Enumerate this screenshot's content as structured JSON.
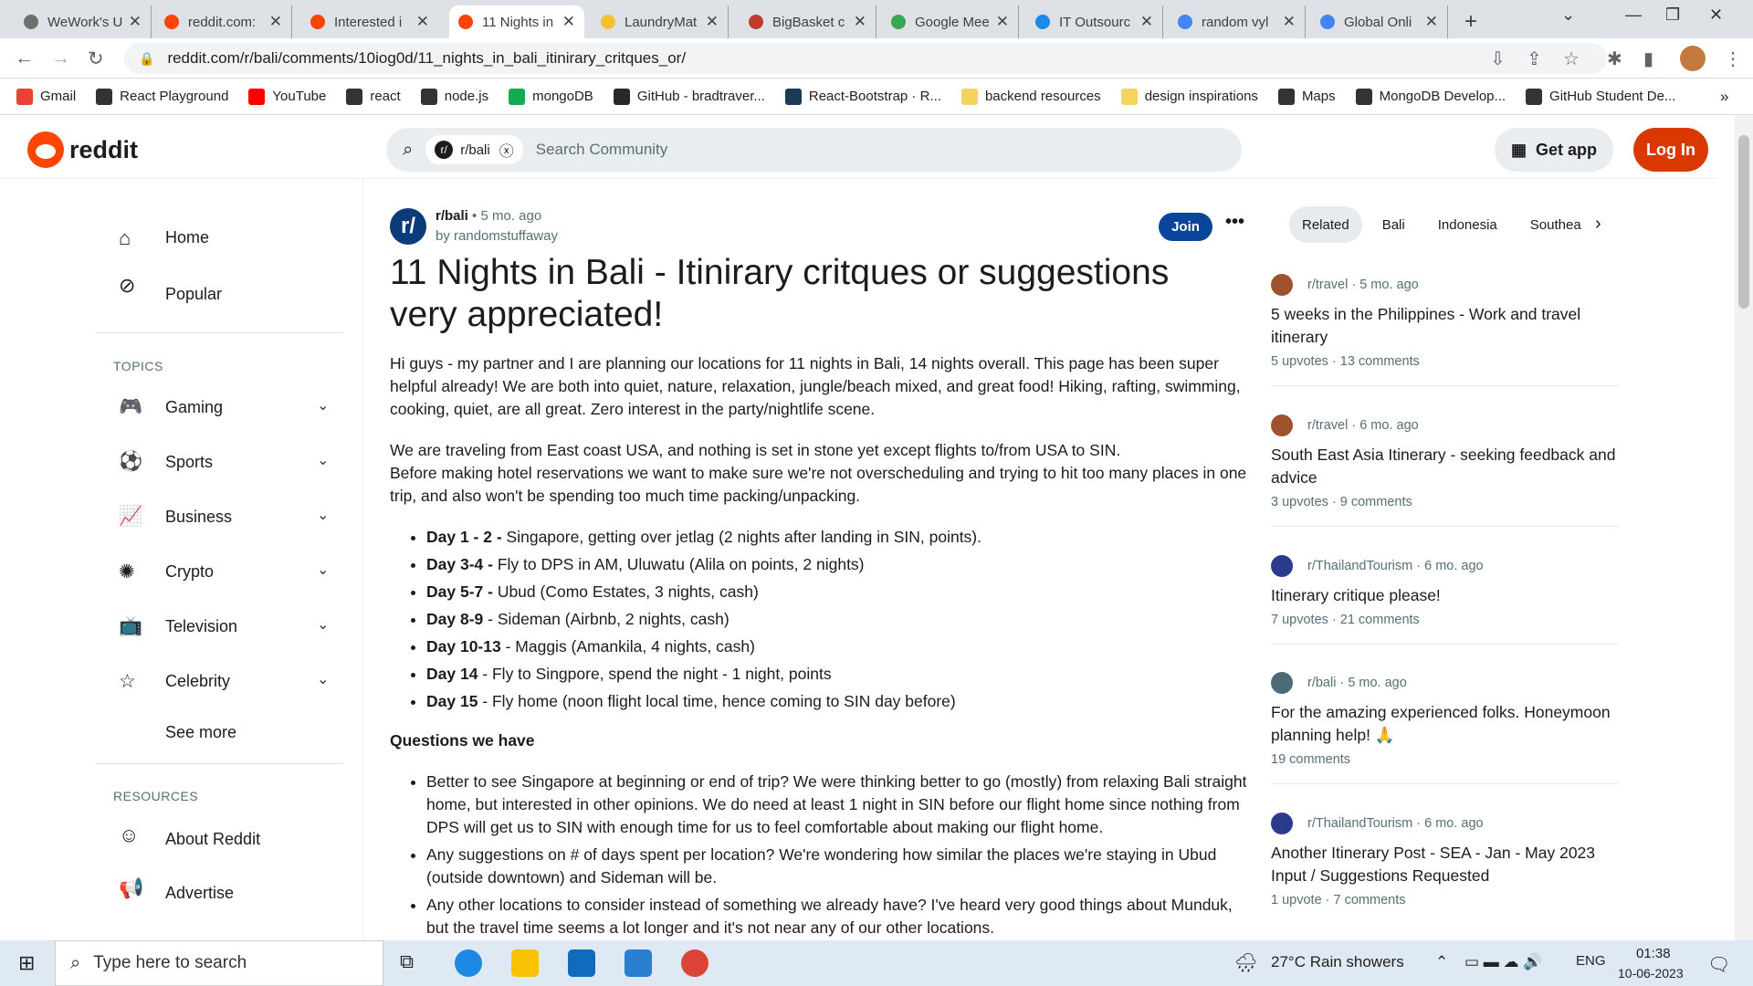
{
  "browser": {
    "tabs": [
      {
        "title": "WeWork's U",
        "color": "#6f6f6f"
      },
      {
        "title": "reddit.com:",
        "color": "#ff4500"
      },
      {
        "title": "Interested i",
        "color": "#ff4500"
      },
      {
        "title": "11 Nights in",
        "color": "#ff4500"
      },
      {
        "title": "LaundryMat",
        "color": "#f2c230"
      },
      {
        "title": "BigBasket c",
        "color": "#c0392b"
      },
      {
        "title": "Google Mee",
        "color": "#34a853"
      },
      {
        "title": "IT Outsourc",
        "color": "#1e88e5"
      },
      {
        "title": "random vyl",
        "color": "#4285f4"
      },
      {
        "title": "Global Onli",
        "color": "#4285f4"
      }
    ],
    "new_tab": "+",
    "url": "reddit.com/r/bali/comments/10iog0d/11_nights_in_bali_itinirary_critques_or/",
    "bookmarks": [
      {
        "label": "Gmail",
        "color": "#ea4335"
      },
      {
        "label": "React Playground",
        "color": "#333"
      },
      {
        "label": "YouTube",
        "color": "#ff0000"
      },
      {
        "label": "react",
        "color": "#333"
      },
      {
        "label": "node.js",
        "color": "#333"
      },
      {
        "label": "mongoDB",
        "color": "#13aa52"
      },
      {
        "label": "GitHub - bradtraver...",
        "color": "#24292e"
      },
      {
        "label": "React-Bootstrap · R...",
        "color": "#1a3a5a"
      },
      {
        "label": "backend resources",
        "color": "#f4d35e"
      },
      {
        "label": "design inspirations",
        "color": "#f4d35e"
      },
      {
        "label": "Maps",
        "color": "#333"
      },
      {
        "label": "MongoDB Develop...",
        "color": "#333"
      },
      {
        "label": "GitHub Student De...",
        "color": "#333"
      }
    ],
    "more": "»"
  },
  "header": {
    "logo": "reddit",
    "chip": "r/bali",
    "chip_icon": "r/",
    "search_placeholder": "Search Community",
    "get_app": "Get app",
    "login": "Log In"
  },
  "leftnav": {
    "home": "Home",
    "popular": "Popular",
    "topics_heading": "TOPICS",
    "topics": [
      "Gaming",
      "Sports",
      "Business",
      "Crypto",
      "Television",
      "Celebrity"
    ],
    "see_more": "See more",
    "resources_heading": "RESOURCES",
    "resources": [
      "About Reddit",
      "Advertise"
    ]
  },
  "post": {
    "sub_icon": "r/",
    "subreddit": "r/bali",
    "age": "• 5 mo. ago",
    "author": "by randomstuffaway",
    "join": "Join",
    "more": "•••",
    "title": "11 Nights in Bali - Itinirary critques or suggestions very appreciated!",
    "p1": "Hi guys - my partner and I are planning our locations for 11 nights in Bali, 14 nights overall. This page has been super helpful already! We are both into quiet, nature, relaxation, jungle/beach mixed, and great food! Hiking, rafting, swimming, cooking, quiet, are all great. Zero interest in the party/nightlife scene.",
    "p2a": "We are traveling from East coast USA, and nothing is set in stone yet except flights to/from USA to SIN.",
    "p2b": "Before making hotel reservations we want to make sure we're not overscheduling and trying to hit too many places in one trip, and also won't be spending too much time packing/unpacking.",
    "days": [
      {
        "day": "Day 1 - 2 -",
        "text": " Singapore, getting over jetlag (2 nights after landing in SIN, points)."
      },
      {
        "day": "Day 3-4 -",
        "text": " Fly to DPS in AM, Uluwatu (Alila on points, 2 nights)"
      },
      {
        "day": "Day 5-7 -",
        "text": " Ubud (Como Estates, 3 nights, cash)"
      },
      {
        "day": "Day 8-9",
        "text": " - Sideman (Airbnb, 2 nights, cash)"
      },
      {
        "day": "Day 10-13",
        "text": " - Maggis (Amankila, 4 nights, cash)"
      },
      {
        "day": "Day 14",
        "text": " - Fly to Singpore, spend the night - 1 night, points"
      },
      {
        "day": "Day 15",
        "text": " - Fly home (noon flight local time, hence coming to SIN day before)"
      }
    ],
    "questions_heading": "Questions we have",
    "questions": [
      "Better to see Singapore at beginning or end of trip? We were thinking better to go (mostly) from relaxing Bali straight home, but interested in other opinions. We do need at least 1 night in SIN before our flight home since nothing from DPS will get us to SIN with enough time for us to feel comfortable about making our flight home.",
      "Any suggestions on # of days spent per location? We're wondering how similar the places we're staying in Ubud (outside downtown) and Sideman will be.",
      "Any other locations to consider instead of something we already have? I've heard very good things about Munduk, but the travel time seems a lot longer and it's not near any of our other locations."
    ]
  },
  "related": {
    "pills": [
      "Related",
      "Bali",
      "Indonesia",
      "Southea"
    ],
    "items": [
      {
        "sub": "r/travel",
        "age": "· 5 mo. ago",
        "title": "5 weeks in the Philippines - Work and travel itinerary",
        "stats": "5 upvotes  ·  13 comments",
        "color": "#a0522d"
      },
      {
        "sub": "r/travel",
        "age": "· 6 mo. ago",
        "title": "South East Asia Itinerary - seeking feedback and advice",
        "stats": "3 upvotes  ·  9 comments",
        "color": "#a0522d"
      },
      {
        "sub": "r/ThailandTourism",
        "age": "· 6 mo. ago",
        "title": "Itinerary critique please!",
        "stats": "7 upvotes  ·  21 comments",
        "color": "#2b3a8c"
      },
      {
        "sub": "r/bali",
        "age": "· 5 mo. ago",
        "title": "For the amazing experienced folks. Honeymoon planning help! 🙏",
        "stats": "19 comments",
        "color": "#4d6b74"
      },
      {
        "sub": "r/ThailandTourism",
        "age": "· 6 mo. ago",
        "title": "Another Itinerary Post - SEA - Jan - May 2023 Input / Suggestions Requested",
        "stats": "1 upvote  ·  7 comments",
        "color": "#2b3a8c"
      }
    ]
  },
  "taskbar": {
    "search": "Type here to search",
    "weather": "27°C  Rain showers",
    "lang": "ENG",
    "time": "01:38",
    "date": "10-06-2023"
  }
}
